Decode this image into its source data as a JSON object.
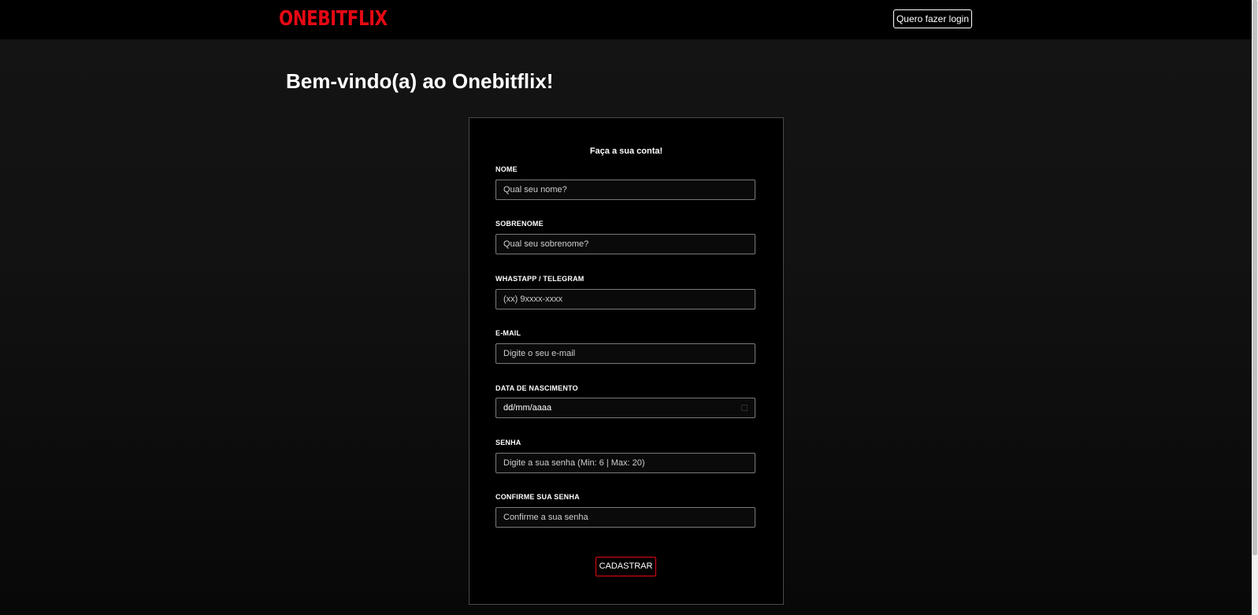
{
  "header": {
    "logo_text": "ONEBITFLIX",
    "login_button_label": "Quero fazer login"
  },
  "page": {
    "title": "Bem-vindo(a) ao Onebitflix!"
  },
  "form": {
    "title": "Faça a sua conta!",
    "fields": [
      {
        "label": "NOME",
        "placeholder": "Qual seu nome?"
      },
      {
        "label": "SOBRENOME",
        "placeholder": "Qual seu sobrenome?"
      },
      {
        "label": "WHASTAPP / TELEGRAM",
        "placeholder": "(xx) 9xxxx-xxxx"
      },
      {
        "label": "E-MAIL",
        "placeholder": "Digite o seu e-mail"
      },
      {
        "label": "DATA DE NASCIMENTO",
        "placeholder": "dd/mm/aaaa"
      },
      {
        "label": "SENHA",
        "placeholder": "Digite a sua senha (Min: 6 | Max: 20)"
      },
      {
        "label": "CONFIRME SUA SENHA",
        "placeholder": "Confirme a sua senha"
      }
    ],
    "submit_label": "CADASTRAR"
  },
  "colors": {
    "brand_red": "#e50914",
    "background": "#121212",
    "card_background": "#000000"
  },
  "icons": {
    "date_picker": "calendar-icon"
  }
}
